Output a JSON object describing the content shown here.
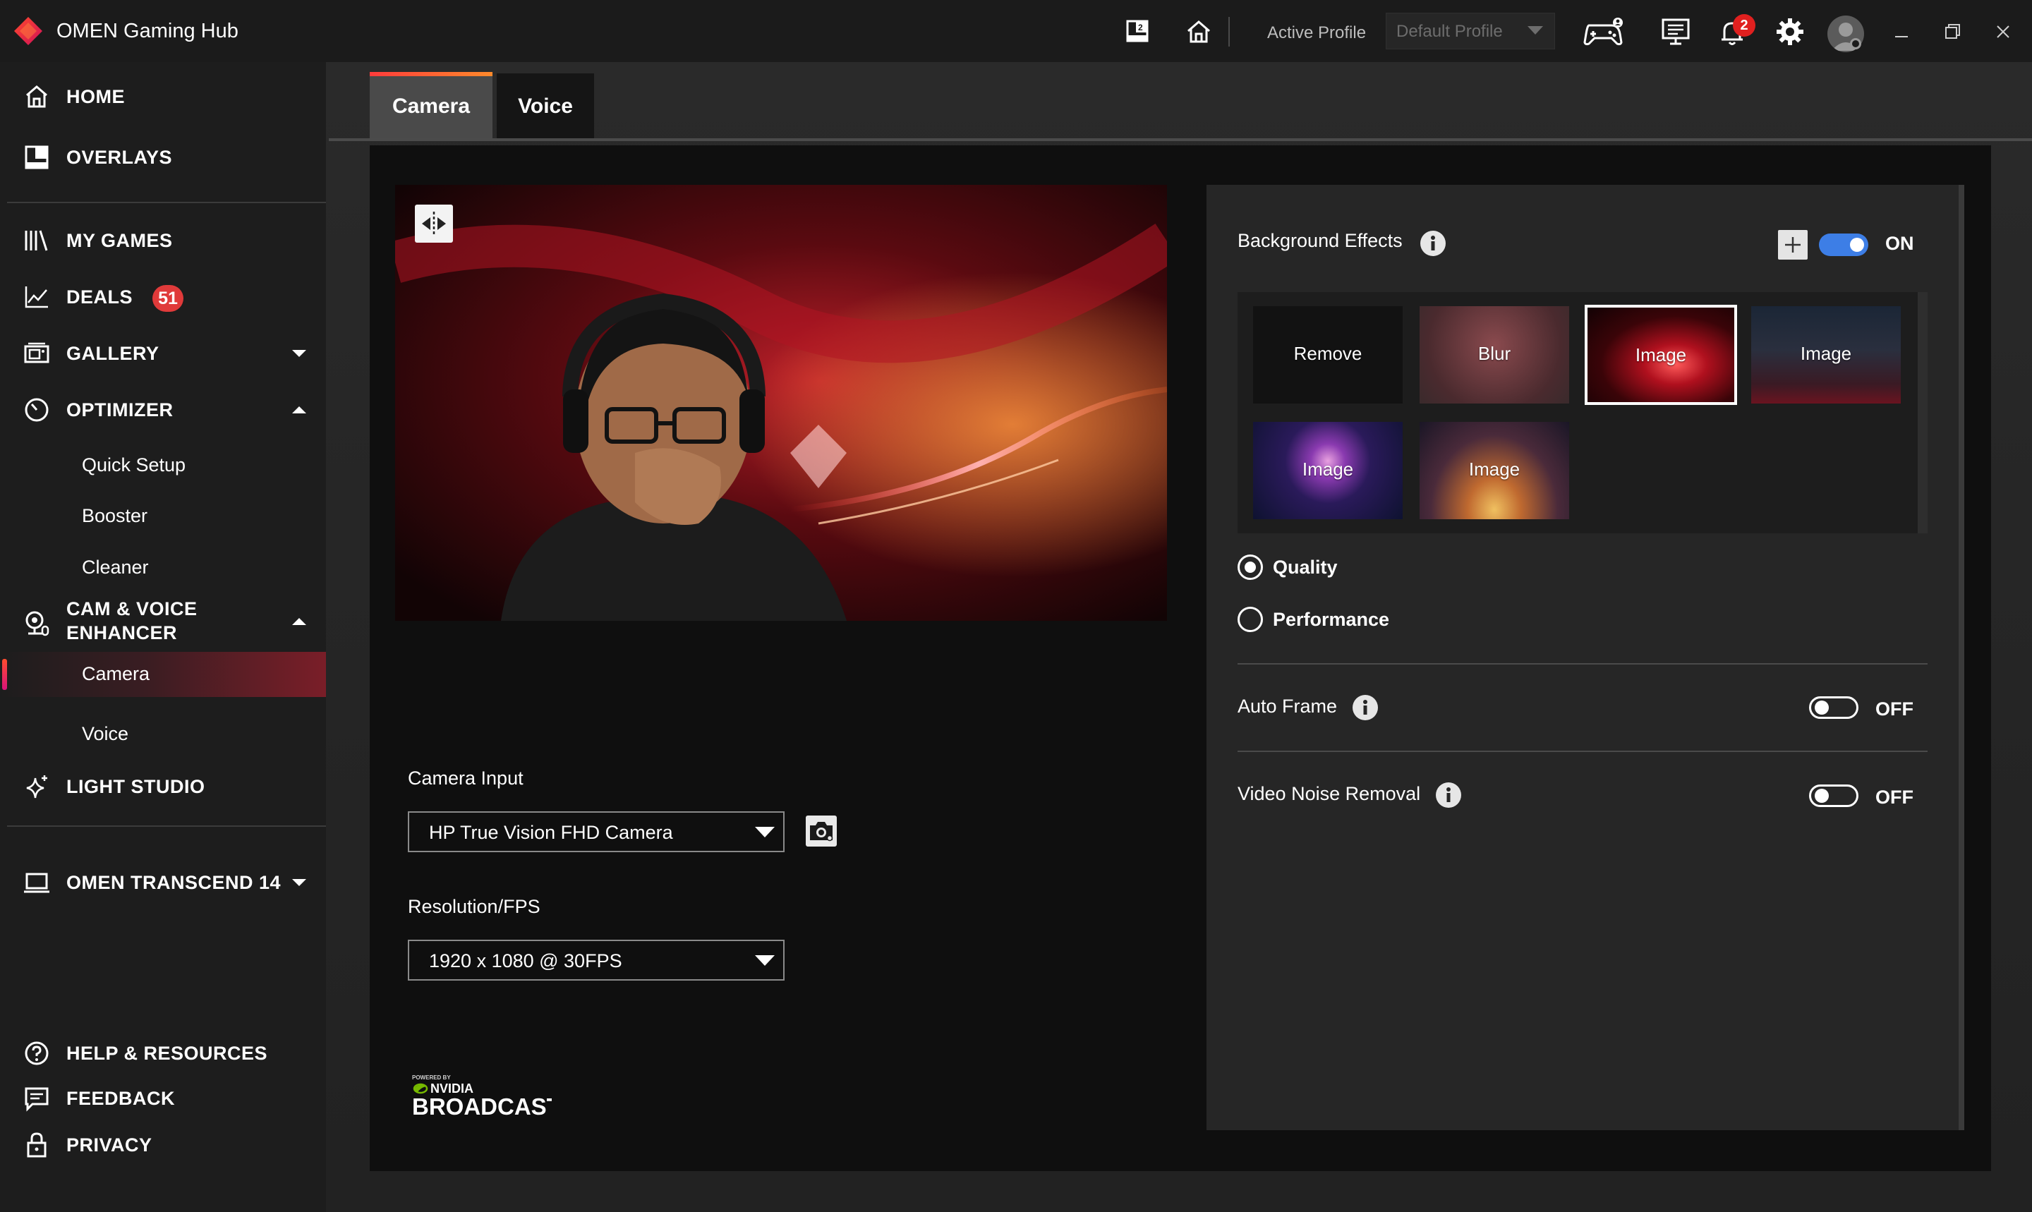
{
  "app": {
    "title": "OMEN Gaming Hub"
  },
  "topbar": {
    "active_profile_label": "Active Profile",
    "profile_value": "Default Profile",
    "notification_count": "2",
    "icons": [
      "overlay-icon",
      "home-icon",
      "controller-icon",
      "monitor-icon",
      "bell-icon",
      "gear-icon",
      "avatar",
      "minimize-icon",
      "restore-icon",
      "close-icon"
    ]
  },
  "sidebar": {
    "home": "HOME",
    "overlays": "OVERLAYS",
    "my_games": "MY GAMES",
    "deals": "DEALS",
    "deals_count": "51",
    "gallery": "GALLERY",
    "optimizer": "OPTIMIZER",
    "quick_setup": "Quick Setup",
    "booster": "Booster",
    "cleaner": "Cleaner",
    "cam_voice_line1": "CAM & VOICE",
    "cam_voice_line2": "ENHANCER",
    "camera": "Camera",
    "voice": "Voice",
    "light_studio": "LIGHT STUDIO",
    "device": "OMEN TRANSCEND 14",
    "help": "HELP & RESOURCES",
    "feedback": "FEEDBACK",
    "privacy": "PRIVACY"
  },
  "tabs": {
    "camera": "Camera",
    "voice": "Voice"
  },
  "camera_settings": {
    "camera_input_label": "Camera Input",
    "camera_input_value": "HP True Vision FHD Camera",
    "resolution_label": "Resolution/FPS",
    "resolution_value": "1920 x 1080 @ 30FPS",
    "powered_by": "POWERED BY",
    "nvidia": "NVIDIA",
    "broadcast": "BROADCAST"
  },
  "effects": {
    "background_effects_label": "Background Effects",
    "background_effects_state": "ON",
    "tiles": [
      {
        "label": "Remove",
        "selected": false
      },
      {
        "label": "Blur",
        "selected": false
      },
      {
        "label": "Image",
        "selected": true
      },
      {
        "label": "Image",
        "selected": false
      },
      {
        "label": "Image",
        "selected": false
      },
      {
        "label": "Image",
        "selected": false
      }
    ],
    "mode_quality": "Quality",
    "mode_performance": "Performance",
    "selected_mode": "Quality",
    "auto_frame_label": "Auto Frame",
    "auto_frame_state": "OFF",
    "noise_removal_label": "Video Noise Removal",
    "noise_removal_state": "OFF"
  },
  "colors": {
    "accent_red": "#e0201f",
    "toggle_on": "#3d7ee6",
    "camera_selected_bg": "#7a1e28"
  }
}
